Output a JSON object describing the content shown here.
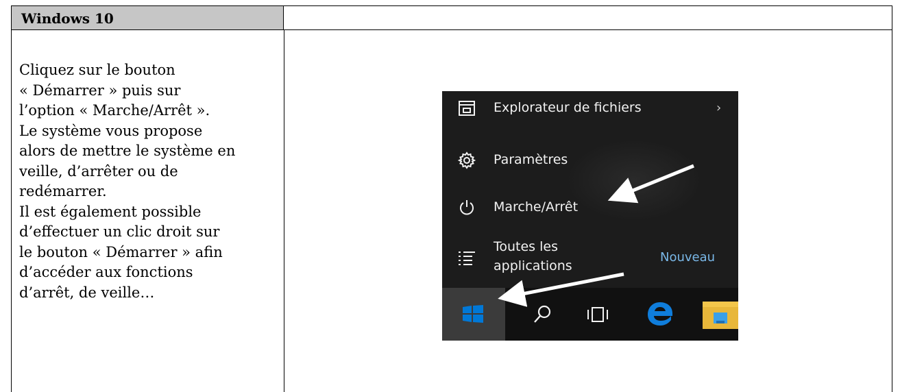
{
  "header": {
    "title": "Windows 10"
  },
  "instructions": {
    "lines": [
      "Cliquez sur le bouton",
      "« Démarrer » puis sur",
      "l’option « Marche/Arrêt ».",
      "Le système vous propose",
      "alors de mettre le système en",
      "veille, d’arrêter ou de",
      "redémarrer.",
      "Il est également possible",
      "d’effectuer un clic droit sur",
      "le bouton « Démarrer » afin",
      "d’accéder aux fonctions",
      "d’arrêt, de veille…"
    ]
  },
  "start_menu": {
    "items": [
      {
        "label": "Explorateur de fichiers",
        "icon": "file-explorer-icon"
      },
      {
        "label": "Paramètres",
        "icon": "gear-icon"
      },
      {
        "label": "Marche/Arrêt",
        "icon": "power-icon"
      },
      {
        "label_line1": "Toutes les",
        "label_line2": "applications",
        "icon": "list-icon"
      }
    ],
    "chevron": "›",
    "badge": "Nouveau"
  },
  "taskbar": {
    "buttons": [
      "windows-start-icon",
      "search-icon",
      "task-view-icon",
      "edge-icon",
      "folder-icon"
    ]
  },
  "colors": {
    "header_bg": "#c6c6c6",
    "menu_bg": "#1c1c1c",
    "accent_blue": "#0078d7",
    "nouveau": "#7ab8e8"
  }
}
